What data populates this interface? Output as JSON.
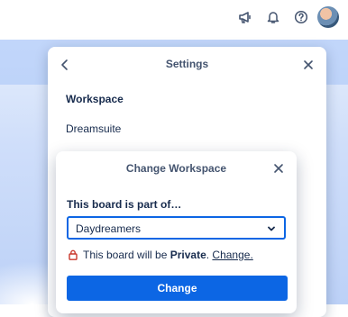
{
  "topbar": {
    "icons": [
      "megaphone-icon",
      "bell-icon",
      "help-icon"
    ]
  },
  "settings": {
    "title": "Settings",
    "workspace_heading": "Workspace",
    "workspace_name": "Dreamsuite"
  },
  "change_workspace": {
    "title": "Change Workspace",
    "label": "This board is part of…",
    "selected_workspace": "Daydreamers",
    "privacy_prefix": "This board will be ",
    "privacy_level": "Private",
    "privacy_period": ". ",
    "privacy_link": "Change.",
    "button_label": "Change"
  },
  "colors": {
    "primary": "#0c66e4",
    "lock": "#c9372c",
    "text": "#172b4d"
  }
}
